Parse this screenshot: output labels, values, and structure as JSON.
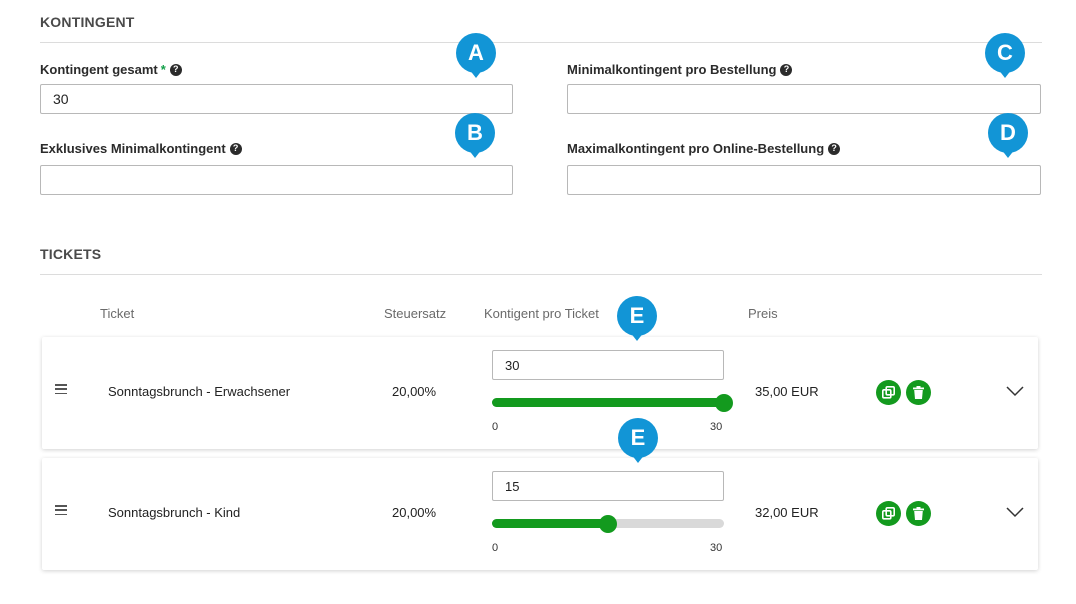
{
  "kontingent": {
    "title": "KONTINGENT",
    "fields": {
      "gesamt": {
        "label": "Kontingent gesamt",
        "required_mark": "*",
        "value": "30",
        "placeholder": ""
      },
      "min_bestellung": {
        "label": "Minimalkontingent pro Bestellung",
        "value": "",
        "placeholder": ""
      },
      "exklusiv_min": {
        "label": "Exklusives Minimalkontingent",
        "value": "",
        "placeholder": ""
      },
      "max_online": {
        "label": "Maximalkontingent pro Online-Bestellung",
        "value": "",
        "placeholder": ""
      }
    },
    "help_glyph": "?"
  },
  "tickets": {
    "title": "TICKETS",
    "columns": {
      "ticket": "Ticket",
      "steuersatz": "Steuersatz",
      "kontingent": "Kontigent pro Ticket",
      "preis": "Preis"
    },
    "rows": [
      {
        "name": "Sonntagsbrunch - Erwachsener",
        "tax": "20,00%",
        "quota_value": "30",
        "slider_min": "0",
        "slider_max": "30",
        "slider_value": 30,
        "price": "35,00 EUR"
      },
      {
        "name": "Sonntagsbrunch - Kind",
        "tax": "20,00%",
        "quota_value": "15",
        "slider_min": "0",
        "slider_max": "30",
        "slider_value": 15,
        "price": "32,00 EUR"
      }
    ]
  },
  "markers": [
    "A",
    "B",
    "C",
    "D",
    "E",
    "E"
  ],
  "icons": {
    "help": "help-circle-icon",
    "copy": "copy-icon",
    "delete": "trash-icon",
    "expand": "chevron-down-icon",
    "drag": "drag-handle-icon"
  },
  "colors": {
    "accent_green": "#139a1e",
    "marker_blue": "#1295d6",
    "required_green": "#14a04a"
  }
}
